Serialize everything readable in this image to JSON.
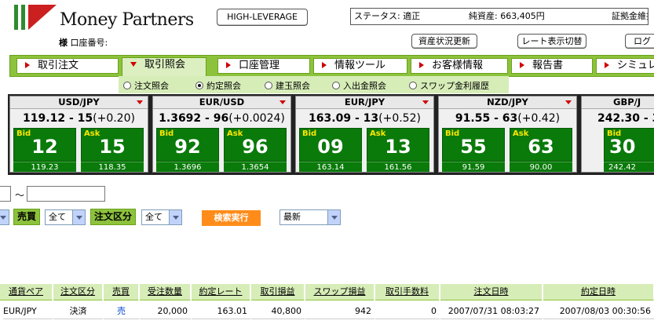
{
  "header": {
    "brand": "Money Partners",
    "account_prefix": "様",
    "account_label": "口座番号:",
    "high_leverage_button": "HIGH-LEVERAGE",
    "status_label": "ステータス: 適正",
    "net_assets_label": "純資産: 663,405円",
    "margin_label": "証拠金維持",
    "asset_status_button": "資産状況更新",
    "rate_toggle_button": "レート表示切替",
    "logout_button": "ログ"
  },
  "nav": {
    "items": [
      "取引注文",
      "取引照会",
      "口座管理",
      "情報ツール",
      "お客様情報",
      "報告書",
      "シミュレ"
    ],
    "active": "取引照会"
  },
  "subnav": {
    "items": [
      "注文照会",
      "約定照会",
      "建玉照会",
      "入出金照会",
      "スワップ金利履歴"
    ],
    "selected": "約定照会"
  },
  "rates": [
    {
      "pair": "USD/JPY",
      "price": "119.12 - 15",
      "change": "(+0.20)",
      "bid_label": "Bid",
      "ask_label": "Ask",
      "bid": "12",
      "ask": "15",
      "low": "119.23",
      "high": "118.35"
    },
    {
      "pair": "EUR/USD",
      "price": "1.3692 - 96",
      "change": "(+0.0024)",
      "bid_label": "Bid",
      "ask_label": "Ask",
      "bid": "92",
      "ask": "96",
      "low": "1.3696",
      "high": "1.3654"
    },
    {
      "pair": "EUR/JPY",
      "price": "163.09 - 13",
      "change": "(+0.52)",
      "bid_label": "Bid",
      "ask_label": "Ask",
      "bid": "09",
      "ask": "13",
      "low": "163.14",
      "high": "161.56"
    },
    {
      "pair": "NZD/JPY",
      "price": "91.55 - 63",
      "change": "(+0.42)",
      "bid_label": "Bid",
      "ask_label": "Ask",
      "bid": "55",
      "ask": "63",
      "low": "91.59",
      "high": "90.00"
    },
    {
      "pair": "GBP/J",
      "price": "242.30 - 3",
      "change": "",
      "bid_label": "Bid",
      "ask_label": "",
      "bid": "30",
      "ask": "",
      "low": "242.42",
      "high": ""
    }
  ],
  "search": {
    "tilde": "～",
    "buy_sell_label": "売買",
    "buy_sell_value": "全て",
    "order_type_label": "注文区分",
    "order_type_value": "全て",
    "execute_button": "検索実行",
    "sort_value": "最新"
  },
  "table": {
    "headers": [
      "通貨ペア",
      "注文区分",
      "売買",
      "受注数量",
      "約定レート",
      "取引損益",
      "スワップ損益",
      "取引手数料",
      "注文日時",
      "約定日時"
    ],
    "rows": [
      {
        "pair": "EUR/JPY",
        "order_type": "決済",
        "side": "売",
        "qty": "20,000",
        "rate": "163.01",
        "pl": "40,800",
        "swap": "942",
        "fee": "0",
        "order_time": "2007/07/31 08:03:27",
        "exec_time": "2007/08/03 00:30:56"
      }
    ]
  },
  "colors": {
    "nav_green": "#8dc23c",
    "rate_green": "#0a7a0a",
    "accent_red": "#d00000",
    "button_orange": "#ff8c1a"
  }
}
